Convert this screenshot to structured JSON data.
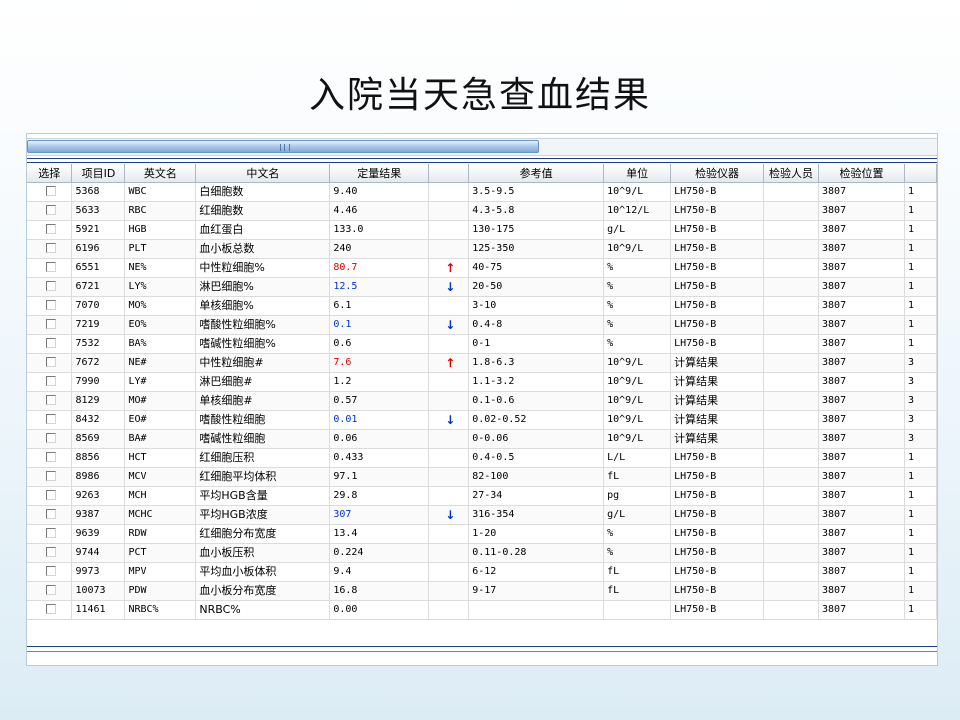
{
  "title": "入院当天急查血结果",
  "columns": [
    "选择",
    "项目ID",
    "英文名",
    "中文名",
    "定量结果",
    "",
    "参考值",
    "单位",
    "检验仪器",
    "检验人员",
    "检验位置",
    ""
  ],
  "rows": [
    {
      "id": "5368",
      "en": "WBC",
      "cn": "白细胞数",
      "result": "9.40",
      "flag": "",
      "ref": "3.5-9.5",
      "unit": "10^9/L",
      "instrument": "LH750-B",
      "staff": "",
      "location": "3807",
      "extra": "1"
    },
    {
      "id": "5633",
      "en": "RBC",
      "cn": "红细胞数",
      "result": "4.46",
      "flag": "",
      "ref": "4.3-5.8",
      "unit": "10^12/L",
      "instrument": "LH750-B",
      "staff": "",
      "location": "3807",
      "extra": "1"
    },
    {
      "id": "5921",
      "en": "HGB",
      "cn": "血红蛋白",
      "result": "133.0",
      "flag": "",
      "ref": "130-175",
      "unit": "g/L",
      "instrument": "LH750-B",
      "staff": "",
      "location": "3807",
      "extra": "1"
    },
    {
      "id": "6196",
      "en": "PLT",
      "cn": "血小板总数",
      "result": "240",
      "flag": "",
      "ref": "125-350",
      "unit": "10^9/L",
      "instrument": "LH750-B",
      "staff": "",
      "location": "3807",
      "extra": "1"
    },
    {
      "id": "6551",
      "en": "NE%",
      "cn": "中性粒细胞%",
      "result": "80.7",
      "flag": "high",
      "ref": "40-75",
      "unit": "%",
      "instrument": "LH750-B",
      "staff": "",
      "location": "3807",
      "extra": "1"
    },
    {
      "id": "6721",
      "en": "LY%",
      "cn": "淋巴细胞%",
      "result": "12.5",
      "flag": "low",
      "ref": "20-50",
      "unit": "%",
      "instrument": "LH750-B",
      "staff": "",
      "location": "3807",
      "extra": "1"
    },
    {
      "id": "7070",
      "en": "MO%",
      "cn": "单核细胞%",
      "result": "6.1",
      "flag": "",
      "ref": "3-10",
      "unit": "%",
      "instrument": "LH750-B",
      "staff": "",
      "location": "3807",
      "extra": "1"
    },
    {
      "id": "7219",
      "en": "EO%",
      "cn": "嗜酸性粒细胞%",
      "result": "0.1",
      "flag": "low",
      "ref": "0.4-8",
      "unit": "%",
      "instrument": "LH750-B",
      "staff": "",
      "location": "3807",
      "extra": "1"
    },
    {
      "id": "7532",
      "en": "BA%",
      "cn": "嗜碱性粒细胞%",
      "result": "0.6",
      "flag": "",
      "ref": "0-1",
      "unit": "%",
      "instrument": "LH750-B",
      "staff": "",
      "location": "3807",
      "extra": "1"
    },
    {
      "id": "7672",
      "en": "NE#",
      "cn": "中性粒细胞#",
      "result": "7.6",
      "flag": "high",
      "ref": "1.8-6.3",
      "unit": "10^9/L",
      "instrument": "计算结果",
      "staff": "",
      "location": "3807",
      "extra": "3"
    },
    {
      "id": "7990",
      "en": "LY#",
      "cn": "淋巴细胞#",
      "result": "1.2",
      "flag": "",
      "ref": "1.1-3.2",
      "unit": "10^9/L",
      "instrument": "计算结果",
      "staff": "",
      "location": "3807",
      "extra": "3"
    },
    {
      "id": "8129",
      "en": "MO#",
      "cn": "单核细胞#",
      "result": "0.57",
      "flag": "",
      "ref": "0.1-0.6",
      "unit": "10^9/L",
      "instrument": "计算结果",
      "staff": "",
      "location": "3807",
      "extra": "3"
    },
    {
      "id": "8432",
      "en": "EO#",
      "cn": "嗜酸性粒细胞",
      "result": "0.01",
      "flag": "low",
      "ref": "0.02-0.52",
      "unit": "10^9/L",
      "instrument": "计算结果",
      "staff": "",
      "location": "3807",
      "extra": "3"
    },
    {
      "id": "8569",
      "en": "BA#",
      "cn": "嗜碱性粒细胞",
      "result": "0.06",
      "flag": "",
      "ref": "0-0.06",
      "unit": "10^9/L",
      "instrument": "计算结果",
      "staff": "",
      "location": "3807",
      "extra": "3"
    },
    {
      "id": "8856",
      "en": "HCT",
      "cn": "红细胞压积",
      "result": "0.433",
      "flag": "",
      "ref": "0.4-0.5",
      "unit": "L/L",
      "instrument": "LH750-B",
      "staff": "",
      "location": "3807",
      "extra": "1"
    },
    {
      "id": "8986",
      "en": "MCV",
      "cn": "红细胞平均体积",
      "result": "97.1",
      "flag": "",
      "ref": "82-100",
      "unit": "fL",
      "instrument": "LH750-B",
      "staff": "",
      "location": "3807",
      "extra": "1"
    },
    {
      "id": "9263",
      "en": "MCH",
      "cn": "平均HGB含量",
      "result": "29.8",
      "flag": "",
      "ref": "27-34",
      "unit": "pg",
      "instrument": "LH750-B",
      "staff": "",
      "location": "3807",
      "extra": "1"
    },
    {
      "id": "9387",
      "en": "MCHC",
      "cn": "平均HGB浓度",
      "result": "307",
      "flag": "low",
      "ref": "316-354",
      "unit": "g/L",
      "instrument": "LH750-B",
      "staff": "",
      "location": "3807",
      "extra": "1"
    },
    {
      "id": "9639",
      "en": "RDW",
      "cn": "红细胞分布宽度",
      "result": "13.4",
      "flag": "",
      "ref": "1-20",
      "unit": "%",
      "instrument": "LH750-B",
      "staff": "",
      "location": "3807",
      "extra": "1"
    },
    {
      "id": "9744",
      "en": "PCT",
      "cn": "血小板压积",
      "result": "0.224",
      "flag": "",
      "ref": "0.11-0.28",
      "unit": "%",
      "instrument": "LH750-B",
      "staff": "",
      "location": "3807",
      "extra": "1"
    },
    {
      "id": "9973",
      "en": "MPV",
      "cn": "平均血小板体积",
      "result": "9.4",
      "flag": "",
      "ref": "6-12",
      "unit": "fL",
      "instrument": "LH750-B",
      "staff": "",
      "location": "3807",
      "extra": "1"
    },
    {
      "id": "10073",
      "en": "PDW",
      "cn": "血小板分布宽度",
      "result": "16.8",
      "flag": "",
      "ref": "9-17",
      "unit": "fL",
      "instrument": "LH750-B",
      "staff": "",
      "location": "3807",
      "extra": "1"
    },
    {
      "id": "11461",
      "en": "NRBC%",
      "cn": "NRBC%",
      "result": "0.00",
      "flag": "",
      "ref": "",
      "unit": "",
      "instrument": "LH750-B",
      "staff": "",
      "location": "3807",
      "extra": "1"
    }
  ],
  "colors": {
    "high": "#e00000",
    "low": "#0033cc",
    "accent": "#1f3f8a"
  },
  "icons": {
    "high": "arrow-up-icon",
    "low": "arrow-down-icon",
    "select": "checkbox-icon"
  }
}
